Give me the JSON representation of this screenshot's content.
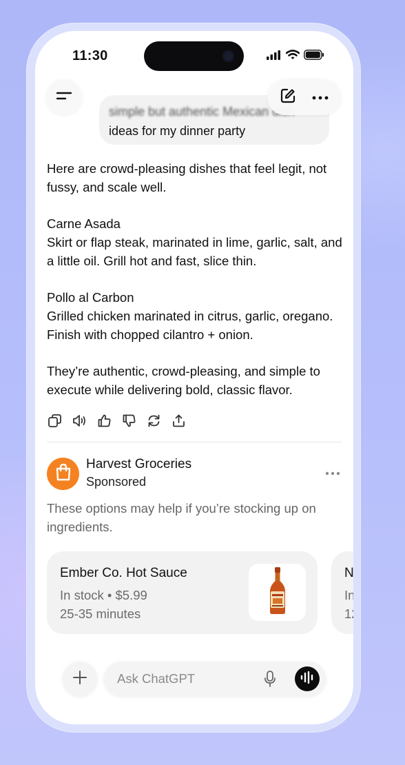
{
  "status_bar": {
    "time": "11:30"
  },
  "header": {
    "menu_icon": "menu-icon",
    "edit_icon": "new-chat-icon",
    "more_icon": "more-icon"
  },
  "conversation": {
    "user_message_blurred": "simple but authentic Mexican dish",
    "user_message": "ideas for my dinner party",
    "intro": "Here are crowd-pleasing dishes that feel legit, not fussy, and scale well.",
    "dishes": [
      {
        "title": "Carne Asada",
        "description": "Skirt or flap steak, marinated in lime, garlic, salt, and a little oil. Grill hot and fast, slice thin."
      },
      {
        "title": "Pollo al Carbon",
        "description": "Grilled chicken marinated in citrus, garlic, oregano. Finish with chopped cilantro + onion."
      }
    ],
    "closing": "They’re authentic, crowd-pleasing, and simple to execute while delivering bold, classic flavor.",
    "message_actions": [
      "copy-icon",
      "read-aloud-icon",
      "thumbs-up-icon",
      "thumbs-down-icon",
      "regenerate-icon",
      "share-icon"
    ]
  },
  "sponsored": {
    "brand_name": "Harvest Groceries",
    "label": "Sponsored",
    "brand_color": "#f58220",
    "description": "These options may help if you’re stocking up on ingredients.",
    "products": [
      {
        "title": "Ember Co. Hot Sauce",
        "availability": "In stock • $5.99",
        "delivery": "25-35 minutes"
      },
      {
        "title": "N",
        "availability": "In",
        "delivery": "12"
      }
    ]
  },
  "composer": {
    "placeholder": "Ask ChatGPT",
    "plus_icon": "plus-icon",
    "mic_icon": "mic-icon",
    "voice_icon": "voice-mode-icon"
  }
}
